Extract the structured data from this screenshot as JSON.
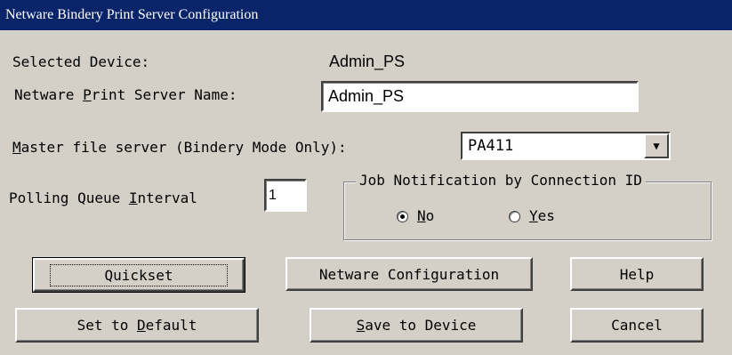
{
  "window": {
    "title": "Netware Bindery Print Server Configuration"
  },
  "selected_device": {
    "label": "Selected Device:",
    "value": "Admin_PS"
  },
  "print_server_name": {
    "label_pre": "Netware ",
    "label_key": "P",
    "label_post": "rint Server Name:",
    "value": "Admin_PS"
  },
  "master_file_server": {
    "label_key": "M",
    "label_post": "aster file server (Bindery Mode Only):",
    "value": "PA411",
    "dropdown_arrow": "▼"
  },
  "polling_queue": {
    "label_pre": "Polling Queue ",
    "label_key": "I",
    "label_post": "nterval",
    "value": "1"
  },
  "job_notification": {
    "title": "Job Notification by Connection ID",
    "options": [
      {
        "key": "N",
        "rest": "o",
        "checked": true
      },
      {
        "key": "Y",
        "rest": "es",
        "checked": false
      }
    ]
  },
  "buttons": {
    "quickset": "Quickset",
    "netware_configuration": "Netware Configuration",
    "help": "Help",
    "set_default_pre": "Set to ",
    "set_default_key": "D",
    "set_default_post": "efault",
    "save_key": "S",
    "save_post": "ave to Device",
    "cancel": "Cancel"
  }
}
